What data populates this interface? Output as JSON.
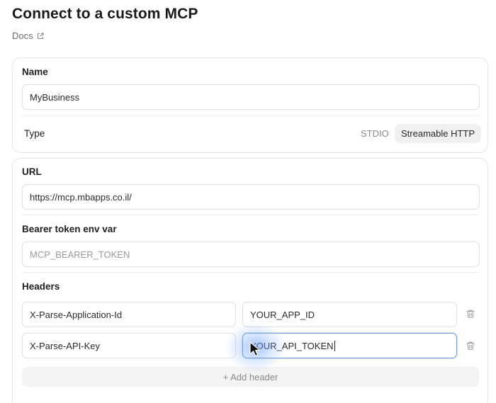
{
  "header": {
    "title": "Connect to a custom MCP",
    "docs_label": "Docs"
  },
  "name_section": {
    "label": "Name",
    "value": "MyBusiness"
  },
  "type_section": {
    "label": "Type",
    "options": [
      "STDIO",
      "Streamable HTTP"
    ],
    "selected": "Streamable HTTP"
  },
  "url_section": {
    "label": "URL",
    "value": "https://mcp.mbapps.co.il/"
  },
  "bearer_section": {
    "label": "Bearer token env var",
    "placeholder": "MCP_BEARER_TOKEN"
  },
  "headers_section": {
    "label": "Headers",
    "rows": [
      {
        "key": "X-Parse-Application-Id",
        "value": "YOUR_APP_ID"
      },
      {
        "key": "X-Parse-API-Key",
        "value": "YOUR_API_TOKEN"
      }
    ],
    "add_label": "+ Add header"
  },
  "icons": {
    "docs": "external-link-icon",
    "delete": "trash-icon",
    "pointer": "cursor-arrow-icon"
  },
  "colors": {
    "focus_border": "#6f9fd8",
    "selected_pill": "#f0f0f0",
    "cursor_glow": "#5a96ff"
  }
}
